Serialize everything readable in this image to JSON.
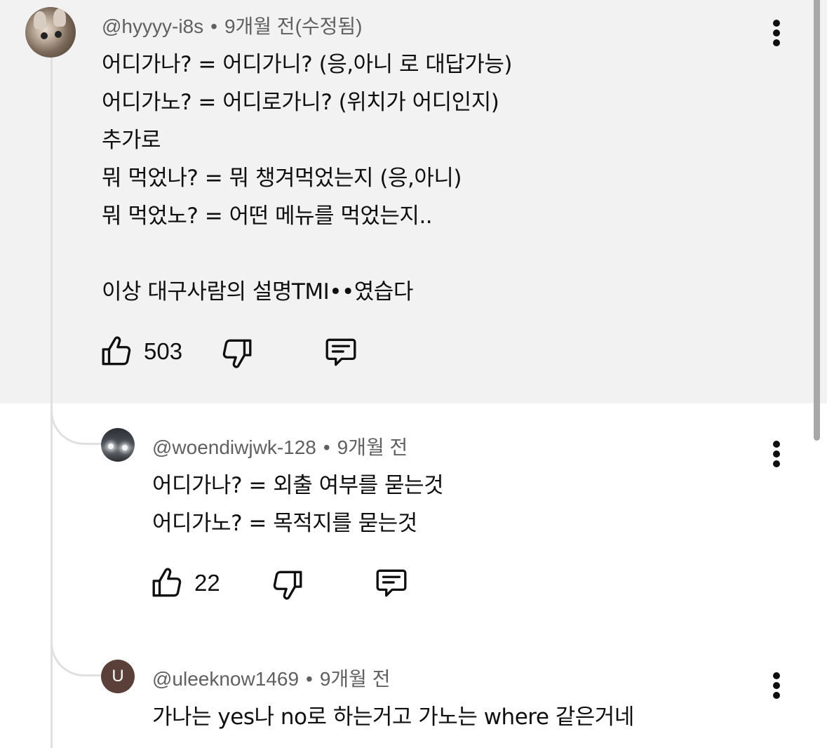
{
  "comments": [
    {
      "author": "@hyyyy-i8s",
      "time": "9개월 전(수정됨)",
      "lines": [
        "어디가나? = 어디가니? (응,아니 로 대답가능)",
        "어디가노? = 어디로가니? (위치가 어디인지)",
        "추가로",
        "뭐 먹었나? = 뭐 챙겨먹었는지 (응,아니)",
        "뭐 먹었노? = 어떤 메뉴를 먹었는지..",
        "",
        "이상 대구사람의 설명TMI••였습다"
      ],
      "likes": "503",
      "highlighted": true
    },
    {
      "author": "@woendiwjwk-128",
      "time": "9개월 전",
      "lines": [
        "어디가나? = 외출 여부를 묻는것",
        "어디가노? = 목적지를 묻는것"
      ],
      "likes": "22"
    },
    {
      "author": "@uleeknow1469",
      "time": "9개월 전",
      "avatar_letter": "U",
      "lines": [
        "가나는 yes나 no로 하는거고 가노는 where 같은거네"
      ]
    }
  ],
  "separator": "•",
  "icons": {
    "like": "thumbs-up-icon",
    "dislike": "thumbs-down-icon",
    "reply": "comment-reply-icon",
    "menu": "more-vertical-icon"
  },
  "colors": {
    "highlight_bg": "#f2f2f2",
    "meta_text": "#606060",
    "body_text": "#0f0f0f",
    "avatar_u_bg": "#5a4038"
  }
}
